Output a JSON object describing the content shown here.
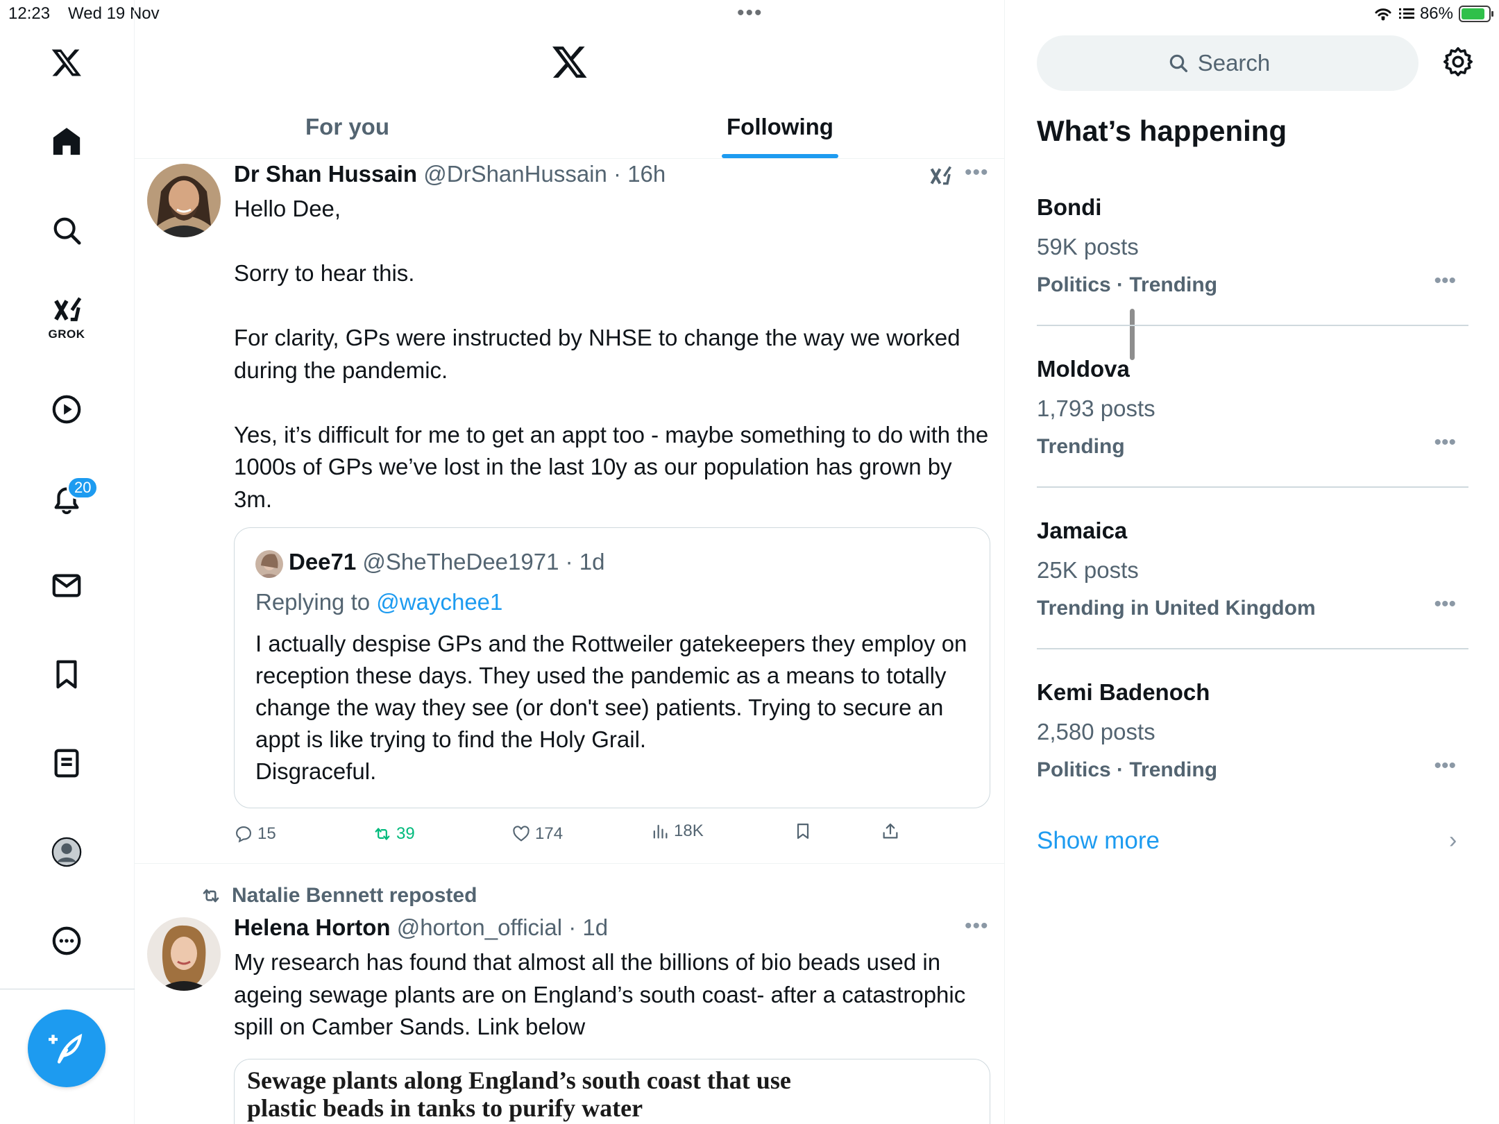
{
  "status_bar": {
    "time": "12:23",
    "date": "Wed 19 Nov",
    "battery": "86%",
    "battery_level": 0.86
  },
  "nav": {
    "notifications_badge": "20",
    "grok_label": "GROK"
  },
  "tabs": [
    {
      "label": "For you",
      "active": false
    },
    {
      "label": "Following",
      "active": true
    }
  ],
  "posts": [
    {
      "name": "Dr Shan Hussain",
      "handle": "@DrShanHussain",
      "time": "· 16h",
      "lines": [
        "Hello Dee,",
        "",
        "Sorry to hear this.",
        "",
        "For clarity, GPs were instructed by NHSE to change the way we worked during the pandemic.",
        "",
        "Yes, it’s difficult for me to get an appt too - maybe something to do with the 1000s of GPs we’ve lost in the last 10y as our population has grown by 3m."
      ],
      "quote": {
        "name": "Dee71",
        "handle": "@SheTheDee1971",
        "time": "· 1d",
        "replying_prefix": "Replying to",
        "replying_to": "@waychee1",
        "text": "I actually despise GPs and the Rottweiler gatekeepers they employ on reception these days. They used the pandemic as a means to totally change the way they see (or don't see) patients. Trying to secure an appt is like trying to find the Holy Grail.",
        "text2": "Disgraceful."
      },
      "stats": {
        "replies": "15",
        "reposts": "39",
        "likes": "174",
        "views": "18K"
      }
    },
    {
      "reposted_by": "Natalie Bennett reposted",
      "name": "Helena Horton",
      "handle": "@horton_official",
      "time": "· 1d",
      "text": "My research has found that almost all the billions of bio beads used in ageing sewage plants are on England’s south coast- after a catastrophic spill on Camber Sands. Link below",
      "card_title": "Sewage plants along England’s south coast that use plastic beads in tanks to purify water"
    }
  ],
  "sidebar": {
    "search_placeholder": "Search",
    "title": "What’s happening",
    "trends": [
      {
        "name": "Bondi",
        "count": "59K posts",
        "context": "Politics · Trending"
      },
      {
        "name": "Moldova",
        "count": "1,793 posts",
        "context": "Trending"
      },
      {
        "name": "Jamaica",
        "count": "25K posts",
        "context": "Trending in United Kingdom"
      },
      {
        "name": "Kemi Badenoch",
        "count": "2,580 posts",
        "context": "Politics · Trending"
      }
    ],
    "show_more": "Show more"
  },
  "colors": {
    "accent": "#1d9bf0",
    "text_primary": "#0f1419",
    "text_secondary": "#536471",
    "repost_green": "#00ba7c",
    "battery_green": "#30c04a"
  }
}
